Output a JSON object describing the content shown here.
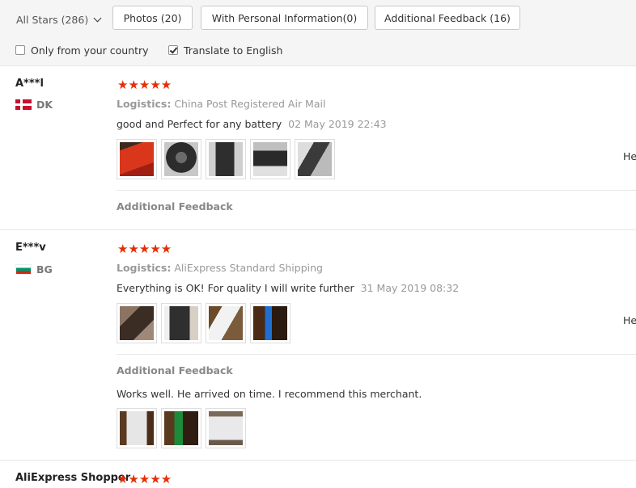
{
  "filters": {
    "sort_label": "All Stars (286)",
    "photos_label": "Photos (20)",
    "personal_info_label": "With Personal Information(0)",
    "additional_feedback_label": "Additional Feedback (16)",
    "only_country_label": "Only from your country",
    "only_country_checked": false,
    "translate_label": "Translate to English",
    "translate_checked": true
  },
  "reviews": [
    {
      "user": "A***l",
      "country": "DK",
      "stars": "★★★★★",
      "rating": 5,
      "logistics_key": "Logistics:",
      "logistics_value": "China Post Registered Air Mail",
      "text": "good and Perfect for any battery",
      "date": "02 May 2019 22:43",
      "photos": [
        "red battery photo",
        "charger photo",
        "charger photo",
        "charger photo",
        "charger photo"
      ],
      "side_text": "He",
      "additional_label": "Additional Feedback",
      "additional_text": ""
    },
    {
      "user": "E***v",
      "country": "BG",
      "stars": "★★★★★",
      "rating": 5,
      "logistics_key": "Logistics:",
      "logistics_value": "AliExpress Standard Shipping",
      "text": "Everything is OK! For quality I will write further",
      "date": "31 May 2019 08:32",
      "photos": [
        "package photo",
        "charger photo",
        "charger photo",
        "charger photo"
      ],
      "side_text": "He",
      "additional_label": "Additional Feedback",
      "additional_text": "Works well. He arrived on time. I recommend this merchant.",
      "additional_photos": [
        "charger photo",
        "charger photo",
        "receipt photo"
      ]
    },
    {
      "user": "AliExpress Shopper",
      "stars": "★★★★★",
      "rating": 5
    }
  ],
  "colors": {
    "star": "#e62e04",
    "muted_text": "#999999",
    "filter_bg": "#f5f5f5"
  },
  "icons": {
    "sort_chevron": "chevron-down-icon",
    "flag_dk": "denmark-flag-icon",
    "flag_bg": "bulgaria-flag-icon",
    "star": "star-icon"
  }
}
